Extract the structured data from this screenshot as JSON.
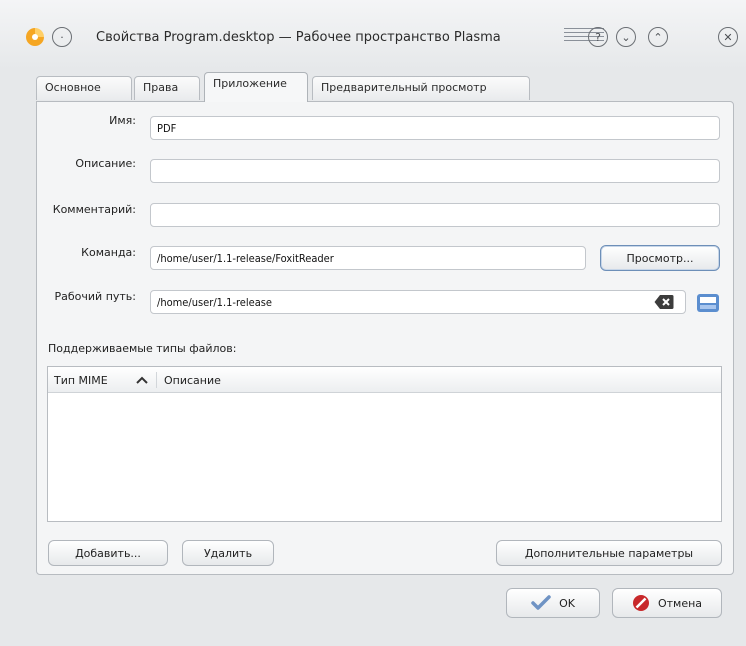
{
  "window": {
    "title": "Свойства Program.desktop — Рабочее пространство Plasma",
    "help_glyph": "?",
    "minimize_glyph": "⌄",
    "maximize_glyph": "⌃",
    "close_glyph": "✕",
    "menu_glyph": "·"
  },
  "tabs": [
    {
      "label": "Основное"
    },
    {
      "label": "Права"
    },
    {
      "label": "Приложение"
    },
    {
      "label": "Предварительный просмотр"
    }
  ],
  "form": {
    "name_label": "Имя:",
    "name_value": "PDF",
    "description_label": "Описание:",
    "description_value": "",
    "comment_label": "Комментарий:",
    "comment_value": "",
    "command_label": "Команда:",
    "command_value": "/home/user/1.1-release/FoxitReader",
    "browse_label": "Просмотр...",
    "workdir_label": "Рабочий путь:",
    "workdir_value": "/home/user/1.1-release"
  },
  "filetypes": {
    "label": "Поддерживаемые типы файлов:",
    "columns": [
      "Тип MIME",
      "Описание"
    ],
    "rows": []
  },
  "actions": {
    "add_label": "Добавить...",
    "remove_label": "Удалить",
    "advanced_label": "Дополнительные параметры"
  },
  "dialog": {
    "ok_label": "OK",
    "cancel_label": "Отмена"
  },
  "colors": {
    "background": "#e6e8ea",
    "accent": "#6d8fb8",
    "cancel_red": "#c8282a"
  }
}
